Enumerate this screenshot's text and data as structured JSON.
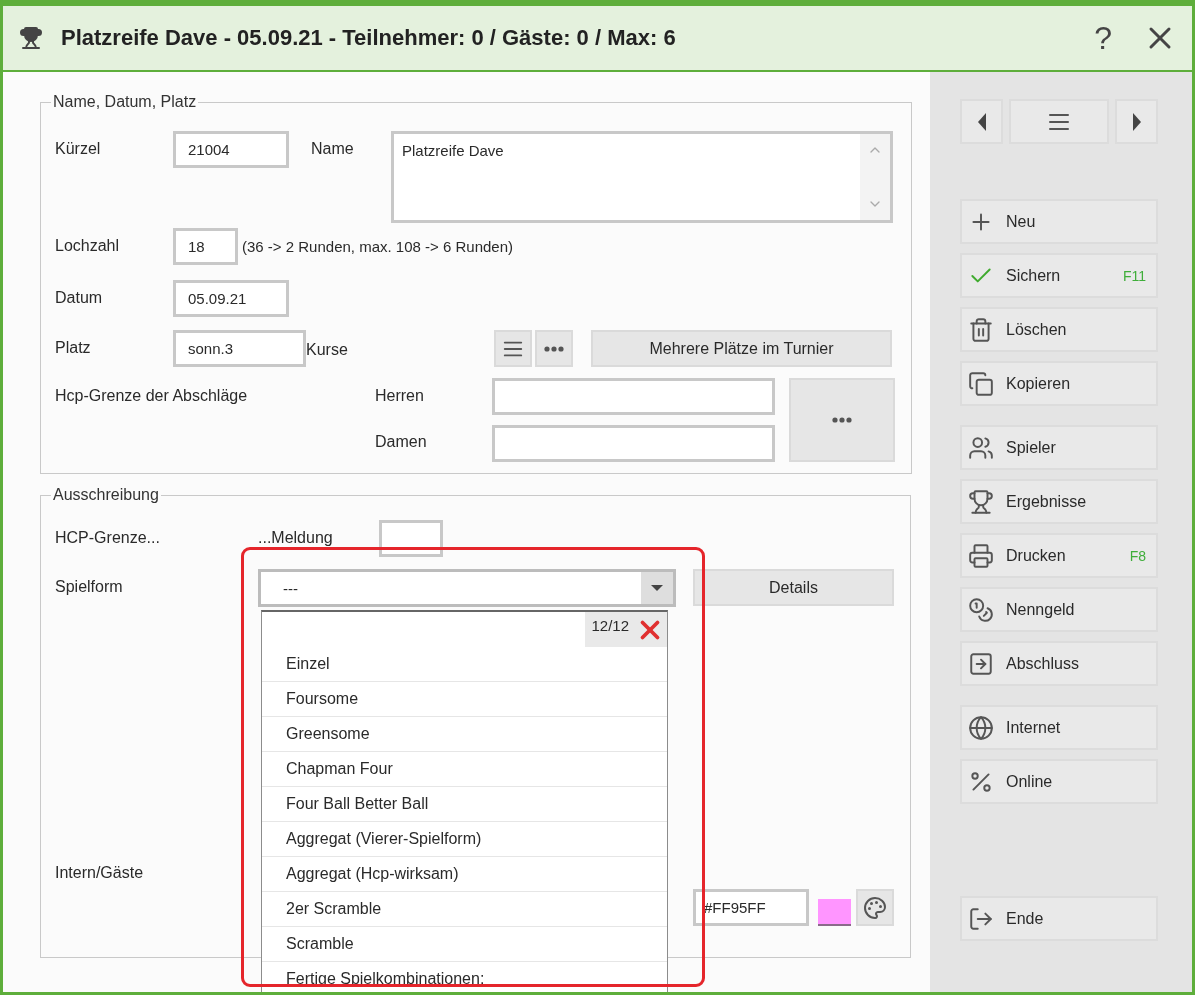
{
  "window": {
    "title": "Platzreife Dave - 05.09.21 - Teilnehmer: 0 / Gäste: 0 / Max: 6",
    "help": "?"
  },
  "general": {
    "legend": "Name, Datum, Platz",
    "kuerzel": {
      "label": "Kürzel",
      "value": "21004"
    },
    "name": {
      "label": "Name",
      "value": "Platzreife Dave"
    },
    "lochzahl": {
      "label": "Lochzahl",
      "value": "18",
      "note": "(36 -> 2 Runden, max. 108 -> 6 Runden)"
    },
    "datum": {
      "label": "Datum",
      "value": "05.09.21"
    },
    "platz": {
      "label": "Platz",
      "value": "sonn.3",
      "suffix": "Kurse"
    },
    "multi_course_button": "Mehrere Plätze im Turnier",
    "hcp_limit": {
      "label": "Hcp-Grenze der Abschläge",
      "herren": "Herren",
      "damen": "Damen"
    }
  },
  "announcement": {
    "legend": "Ausschreibung",
    "hcp_label": "HCP-Grenze...",
    "meldung_label": "...Meldung",
    "spielform": {
      "label": "Spielform",
      "value": "---",
      "expanded": true,
      "details_button": "Details"
    },
    "intern_label": "Intern/Gäste",
    "color_field": {
      "value": "#FF95FF",
      "color": "#ff95ff"
    }
  },
  "dropdown": {
    "counter": "12/12",
    "items": [
      {
        "label": "Einzel",
        "selected": false
      },
      {
        "label": "Foursome",
        "selected": false
      },
      {
        "label": "Greensome",
        "selected": false
      },
      {
        "label": "Chapman Four",
        "selected": false
      },
      {
        "label": "Four Ball Better Ball",
        "selected": false
      },
      {
        "label": "Aggregat (Vierer-Spielform)",
        "selected": false
      },
      {
        "label": "Aggregat (Hcp-wirksam)",
        "selected": false
      },
      {
        "label": "2er Scramble",
        "selected": false
      },
      {
        "label": "Scramble",
        "selected": false
      },
      {
        "label": "Fertige Spielkombinationen:",
        "selected": false
      }
    ]
  },
  "sidebar": {
    "groups": [
      [
        {
          "label": "Neu"
        },
        {
          "label": "Sichern",
          "shortcut": "F11"
        },
        {
          "label": "Löschen"
        },
        {
          "label": "Kopieren"
        }
      ],
      [
        {
          "label": "Spieler"
        },
        {
          "label": "Ergebnisse"
        },
        {
          "label": "Drucken",
          "shortcut": "F8"
        },
        {
          "label": "Nenngeld"
        },
        {
          "label": "Abschluss"
        }
      ],
      [
        {
          "label": "Internet"
        },
        {
          "label": "Online"
        }
      ],
      [
        {
          "label": "Ende"
        }
      ]
    ]
  }
}
